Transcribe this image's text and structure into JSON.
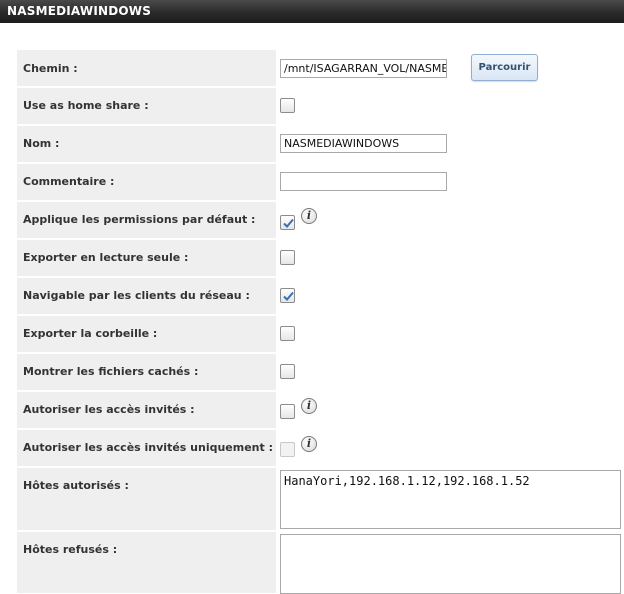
{
  "panel": {
    "title": "NASMEDIAWINDOWS"
  },
  "form": {
    "chemin": {
      "label": "Chemin :",
      "value": "/mnt/ISAGARRAN_VOL/NASMEDIAWINDOWS",
      "browse_label": "Parcourir"
    },
    "home_share": {
      "label": "Use as home share :",
      "checked": false
    },
    "nom": {
      "label": "Nom :",
      "value": "NASMEDIAWINDOWS"
    },
    "commentaire": {
      "label": "Commentaire :",
      "value": ""
    },
    "permissions_defaut": {
      "label": "Applique les permissions par défaut :",
      "checked": true,
      "info_icon": "info-icon"
    },
    "lecture_seule": {
      "label": "Exporter en lecture seule :",
      "checked": false
    },
    "navigable": {
      "label": "Navigable par les clients du réseau :",
      "checked": true
    },
    "corbeille": {
      "label": "Exporter la corbeille :",
      "checked": false
    },
    "fichiers_caches": {
      "label": "Montrer les fichiers cachés :",
      "checked": false
    },
    "acces_invites": {
      "label": "Autoriser les accès invités :",
      "checked": false,
      "info_icon": "info-icon"
    },
    "acces_invites_uniquement": {
      "label": "Autoriser les accès invités uniquement :",
      "checked": false,
      "disabled": true,
      "info_icon": "info-icon"
    },
    "hotes_autorises": {
      "label": "Hôtes autorisés :",
      "value": "HanaYori,192.168.1.12,192.168.1.52"
    },
    "hotes_refuses": {
      "label": "Hôtes refusés :",
      "value": ""
    }
  },
  "colors": {
    "title_bg": "#2a2a2a",
    "label_bg": "#efefef",
    "button_border": "#8fb0d4",
    "check_mark": "#3a6fb5"
  }
}
